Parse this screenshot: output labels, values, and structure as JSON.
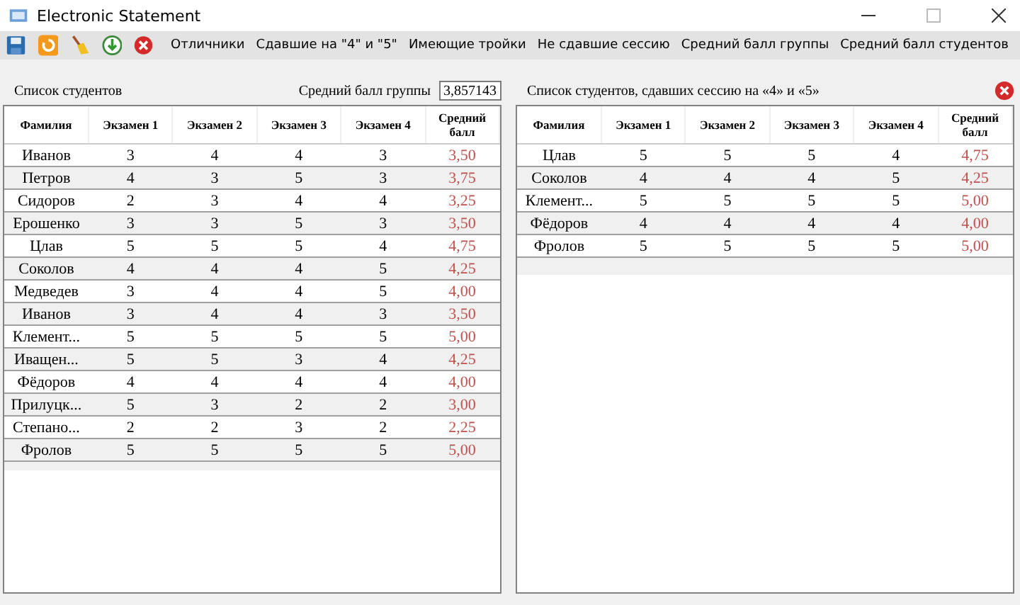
{
  "window": {
    "title": "Electronic Statement"
  },
  "menu": [
    "Отличники",
    "Сдавшие на \"4\" и \"5\"",
    "Имеющие тройки",
    "Не сдавшие сессию",
    "Средний балл группы",
    "Средний балл студентов"
  ],
  "left": {
    "title": "Список студентов",
    "avg_label": "Средний балл группы",
    "avg_value": "3,857143",
    "columns": [
      "Фамилия",
      "Экзамен 1",
      "Экзамен 2",
      "Экзамен 3",
      "Экзамен 4",
      "Средний балл"
    ],
    "rows": [
      {
        "cells": [
          "Иванов",
          "3",
          "4",
          "4",
          "3",
          "3,50"
        ]
      },
      {
        "cells": [
          "Петров",
          "4",
          "3",
          "5",
          "3",
          "3,75"
        ]
      },
      {
        "cells": [
          "Сидоров",
          "2",
          "3",
          "4",
          "4",
          "3,25"
        ]
      },
      {
        "cells": [
          "Ерошенко",
          "3",
          "3",
          "5",
          "3",
          "3,50"
        ]
      },
      {
        "cells": [
          "Цлав",
          "5",
          "5",
          "5",
          "4",
          "4,75"
        ]
      },
      {
        "cells": [
          "Соколов",
          "4",
          "4",
          "4",
          "5",
          "4,25"
        ]
      },
      {
        "cells": [
          "Медведев",
          "3",
          "4",
          "4",
          "5",
          "4,00"
        ]
      },
      {
        "cells": [
          "Иванов",
          "3",
          "4",
          "4",
          "3",
          "3,50"
        ]
      },
      {
        "cells": [
          "Клемент...",
          "5",
          "5",
          "5",
          "5",
          "5,00"
        ]
      },
      {
        "cells": [
          "Иващен...",
          "5",
          "5",
          "3",
          "4",
          "4,25"
        ]
      },
      {
        "cells": [
          "Фёдоров",
          "4",
          "4",
          "4",
          "4",
          "4,00"
        ]
      },
      {
        "cells": [
          "Прилуцк...",
          "5",
          "3",
          "2",
          "2",
          "3,00"
        ]
      },
      {
        "cells": [
          "Степано...",
          "2",
          "2",
          "3",
          "2",
          "2,25"
        ]
      },
      {
        "cells": [
          "Фролов",
          "5",
          "5",
          "5",
          "5",
          "5,00"
        ]
      }
    ]
  },
  "right": {
    "title": "Список студентов, сдавших сессию на «4» и «5»",
    "columns": [
      "Фамилия",
      "Экзамен 1",
      "Экзамен 2",
      "Экзамен 3",
      "Экзамен 4",
      "Средний балл"
    ],
    "rows": [
      {
        "cells": [
          "Цлав",
          "5",
          "5",
          "5",
          "4",
          "4,75"
        ]
      },
      {
        "cells": [
          "Соколов",
          "4",
          "4",
          "4",
          "5",
          "4,25"
        ]
      },
      {
        "cells": [
          "Клемент...",
          "5",
          "5",
          "5",
          "5",
          "5,00"
        ]
      },
      {
        "cells": [
          "Фёдоров",
          "4",
          "4",
          "4",
          "4",
          "4,00"
        ]
      },
      {
        "cells": [
          "Фролов",
          "5",
          "5",
          "5",
          "5",
          "5,00"
        ]
      }
    ]
  }
}
